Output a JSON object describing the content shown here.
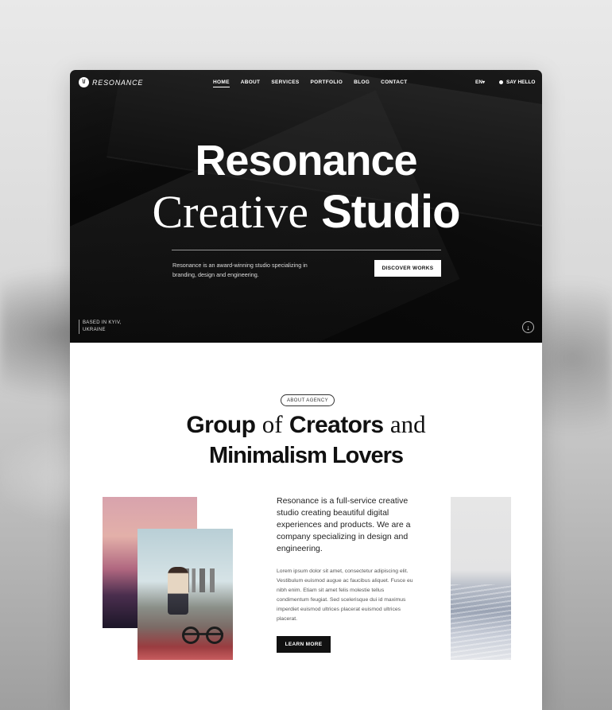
{
  "nav": {
    "logo_text": "RESONANCE",
    "logo_mark": "\\/",
    "items": [
      {
        "label": "HOME",
        "active": true
      },
      {
        "label": "ABOUT",
        "active": false
      },
      {
        "label": "SERVICES",
        "active": false
      },
      {
        "label": "PORTFOLIO",
        "active": false
      },
      {
        "label": "BLOG",
        "active": false
      },
      {
        "label": "CONTACT",
        "active": false
      }
    ],
    "lang": "EN",
    "lang_icon": "chevron-down-icon",
    "say_hello": "SAY HELLO"
  },
  "hero": {
    "title_line1": "Resonance",
    "title_line2_serif": "Creative",
    "title_line2_sans": "Studio",
    "description": "Resonance is an award-winning studio specializing in branding, design and engineering.",
    "cta": "DISCOVER WORKS",
    "location": [
      "BASED IN KYIV,",
      "UKRAINE"
    ],
    "scroll_icon": "arrow-down-icon"
  },
  "about": {
    "badge": "ABOUT AGENCY",
    "heading_line1": {
      "a": "Group",
      "b": "of",
      "c": "Creators",
      "d": "and"
    },
    "heading_line2": "Minimalism Lovers",
    "lead": "Resonance is a full-service creative studio creating beautiful digital experiences and products. We are a company specializing in design and engineering.",
    "body": "Lorem ipsum dolor sit amet, consectetur adipiscing elit. Vestibulum euismod augue ac faucibus aliquet. Fusce eu nibh enim. Etiam sit amet felis molestie tellus condimentum feugiat. Sed scelerisque dui id maximus imperdiet euismod ultrices placerat euismod ultrices placerat.",
    "cta": "LEARN MORE"
  },
  "colors": {
    "hero_bg": "#0b0b0b",
    "accent_dark": "#111111",
    "page_bg": "#ffffff"
  }
}
